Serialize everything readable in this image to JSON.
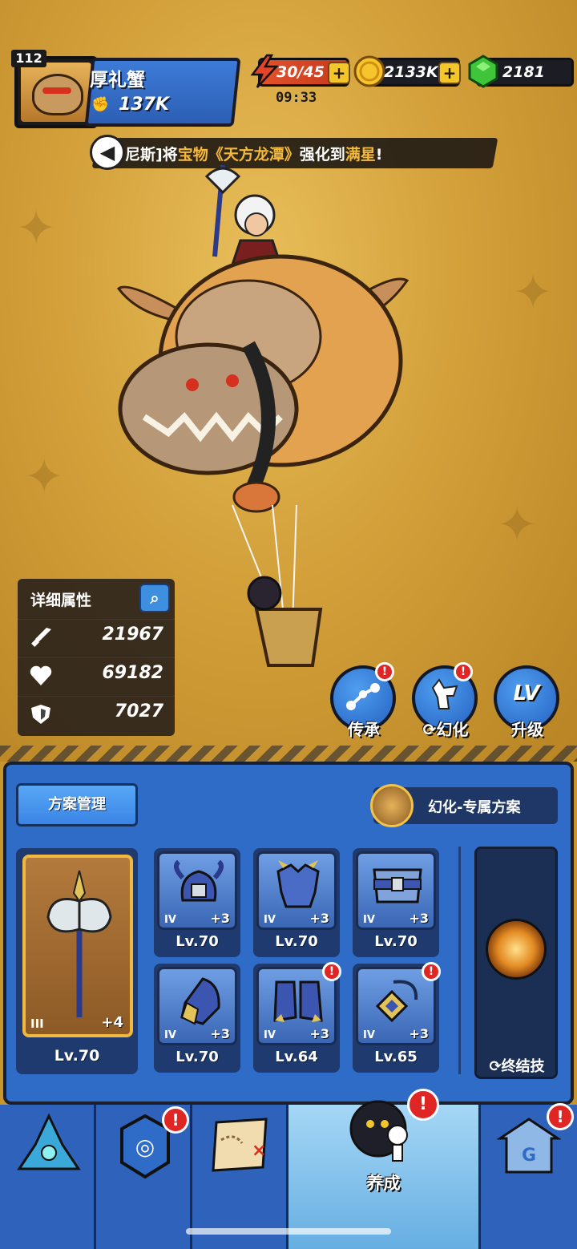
{
  "player": {
    "level": "112",
    "name": "厚礼蟹",
    "power": "137K"
  },
  "resources": {
    "energy": "30/45",
    "timer": "09:33",
    "gold": "2133K",
    "gems": "2181",
    "plus_label": "+"
  },
  "announcement": {
    "prefix": "尼斯]将",
    "item_type": "宝物",
    "item_name": "《天方龙潭》",
    "middle": "强化到",
    "result": "满星",
    "suffix": "!"
  },
  "stats": {
    "title": "详细属性",
    "attack": "21967",
    "health": "69182",
    "defense": "7027"
  },
  "actions": [
    {
      "label": "传承",
      "badge": "!"
    },
    {
      "label": "幻化",
      "badge": "!"
    },
    {
      "label": "升级",
      "badge": ""
    }
  ],
  "panel": {
    "plan_button": "方案管理",
    "exclusive_label": "幻化-专属方案",
    "weapon": {
      "tier": "III",
      "plus": "+4",
      "level": "Lv.70"
    },
    "gear": [
      {
        "name": "helmet",
        "tier": "IV",
        "plus": "+3",
        "level": "Lv.70",
        "badge": false
      },
      {
        "name": "chest-armor",
        "tier": "IV",
        "plus": "+3",
        "level": "Lv.70",
        "badge": false
      },
      {
        "name": "belt-armor",
        "tier": "IV",
        "plus": "+3",
        "level": "Lv.70",
        "badge": false
      },
      {
        "name": "gauntlet",
        "tier": "IV",
        "plus": "+3",
        "level": "Lv.70",
        "badge": false
      },
      {
        "name": "boots",
        "tier": "IV",
        "plus": "+3",
        "level": "Lv.64",
        "badge": true
      },
      {
        "name": "necklace",
        "tier": "IV",
        "plus": "+3",
        "level": "Lv.65",
        "badge": true
      }
    ],
    "finisher_label": "终结技"
  },
  "nav": {
    "active_label": "养成",
    "badge": "!"
  },
  "colors": {
    "panel_blue": "#2f6cc8",
    "accent_gold": "#f3c72c",
    "gem_green": "#3fc43a",
    "alert_red": "#e02525"
  }
}
